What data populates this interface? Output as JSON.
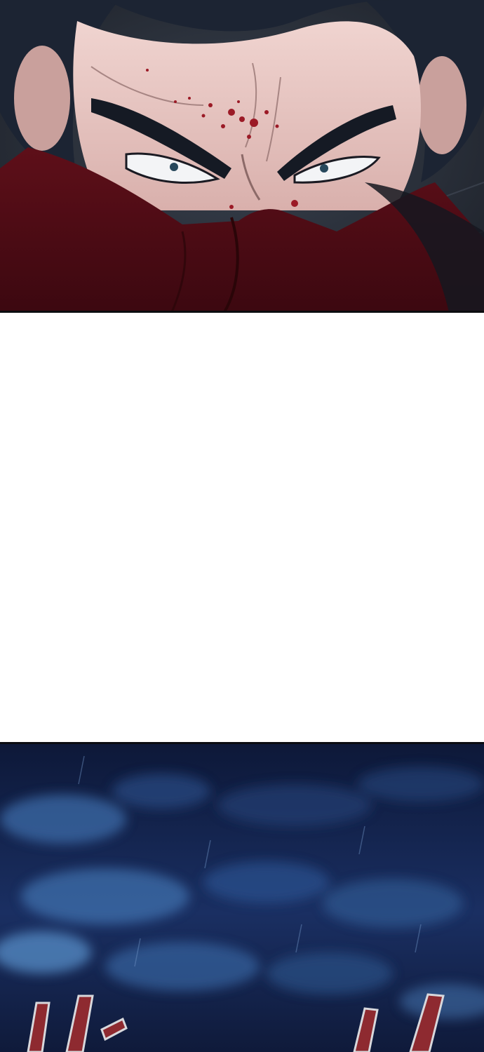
{
  "panels": [
    {
      "id": "panel-1",
      "scene": "masked-face-closeup",
      "colors": {
        "skin": "#e8c8c4",
        "hair": "#1c2433",
        "mask": "#7a1622",
        "blood": "#9b1a26",
        "background": "#2a2f38"
      }
    },
    {
      "id": "panel-2",
      "scene": "night-sky",
      "colors": {
        "sky_dark": "#0e1a3a",
        "sky_mid": "#1e3c78",
        "sky_light": "#4f82c0",
        "glyph": "#8e2a30"
      }
    }
  ]
}
